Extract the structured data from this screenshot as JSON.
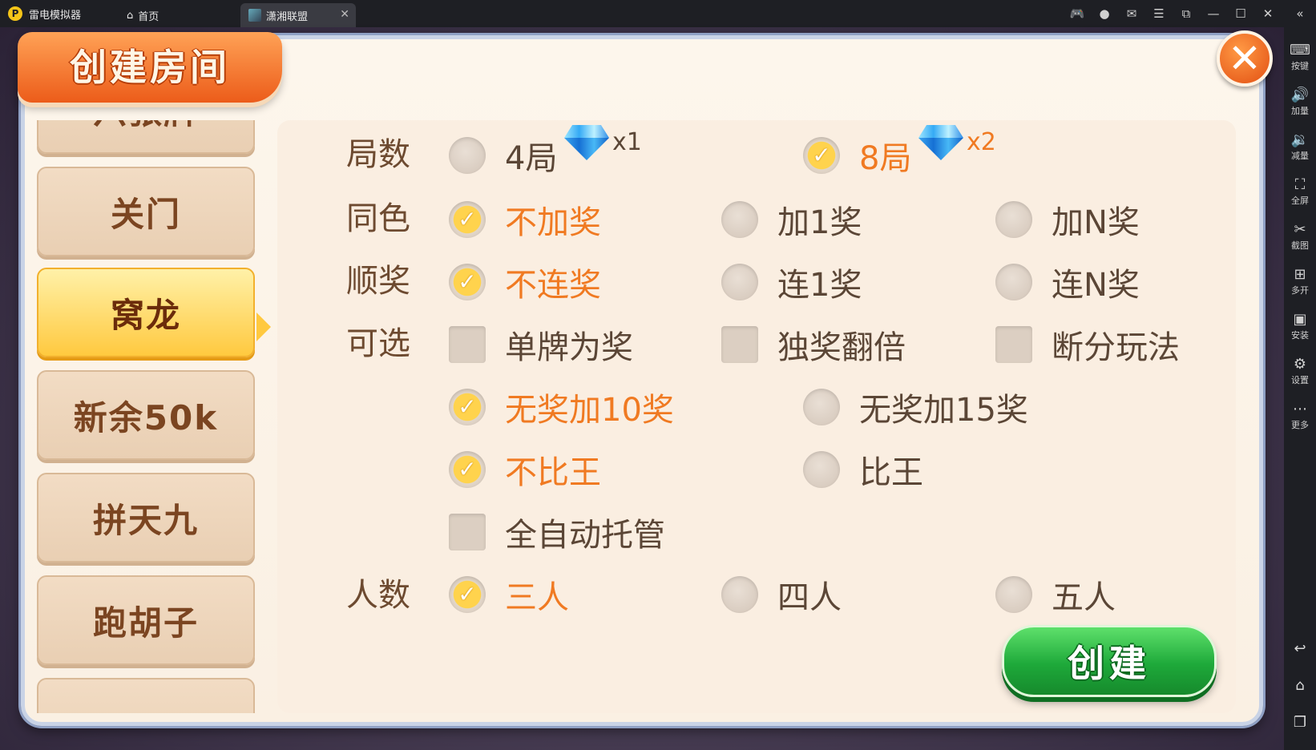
{
  "window": {
    "app_name": "雷电模拟器",
    "tabs": [
      {
        "label": "首页"
      },
      {
        "label": "潇湘联盟"
      }
    ],
    "controls": [
      "gamepad-icon",
      "user-icon",
      "mail-icon",
      "menu-icon",
      "popout-icon",
      "minimize-icon",
      "maximize-icon",
      "close-icon",
      "collapse-icon"
    ]
  },
  "sidebar": {
    "items": [
      {
        "label": "按键",
        "icon": "keyboard-icon"
      },
      {
        "label": "加量",
        "icon": "volume-up-icon"
      },
      {
        "label": "减量",
        "icon": "volume-down-icon"
      },
      {
        "label": "全屏",
        "icon": "fullscreen-icon"
      },
      {
        "label": "截图",
        "icon": "scissors-icon"
      },
      {
        "label": "多开",
        "icon": "multi-instance-icon"
      },
      {
        "label": "安装",
        "icon": "apk-icon"
      },
      {
        "label": "设置",
        "icon": "gear-icon"
      },
      {
        "label": "更多",
        "icon": "more-icon"
      }
    ],
    "nav": [
      "back-icon",
      "home-icon",
      "recent-apps-icon"
    ]
  },
  "dialog": {
    "title": "创建房间",
    "create_label": "创建",
    "games": [
      {
        "label": "六张牌",
        "active": false
      },
      {
        "label": "关门",
        "active": false
      },
      {
        "label": "窝龙",
        "active": true
      },
      {
        "label": "新余50k",
        "active": false
      },
      {
        "label": "拼天九",
        "active": false
      },
      {
        "label": "跑胡子",
        "active": false
      }
    ],
    "rows": {
      "rounds": {
        "label": "局数",
        "options": [
          {
            "text": "4局",
            "checked": false,
            "cost": "x1"
          },
          {
            "text": "8局",
            "checked": true,
            "cost": "x2"
          }
        ]
      },
      "same_color": {
        "label": "同色",
        "options": [
          {
            "text": "不加奖",
            "checked": true
          },
          {
            "text": "加1奖",
            "checked": false
          },
          {
            "text": "加N奖",
            "checked": false
          }
        ]
      },
      "straight": {
        "label": "顺奖",
        "options": [
          {
            "text": "不连奖",
            "checked": true
          },
          {
            "text": "连1奖",
            "checked": false
          },
          {
            "text": "连N奖",
            "checked": false
          }
        ]
      },
      "optional": {
        "label": "可选",
        "options": [
          {
            "text": "单牌为奖",
            "checked": false
          },
          {
            "text": "独奖翻倍",
            "checked": false
          },
          {
            "text": "断分玩法",
            "checked": false
          },
          {
            "text": "无奖加10奖",
            "checked": true
          },
          {
            "text": "无奖加15奖",
            "checked": false
          },
          {
            "text": "不比王",
            "checked": true
          },
          {
            "text": "比王",
            "checked": false
          },
          {
            "text": "全自动托管",
            "checked": false
          }
        ]
      },
      "players": {
        "label": "人数",
        "options": [
          {
            "text": "三人",
            "checked": true
          },
          {
            "text": "四人",
            "checked": false
          },
          {
            "text": "五人",
            "checked": false
          }
        ]
      }
    }
  },
  "colors": {
    "accent_orange": "#f07a22",
    "create_green": "#1ea93a",
    "title_orange": "#ec5c1a"
  }
}
